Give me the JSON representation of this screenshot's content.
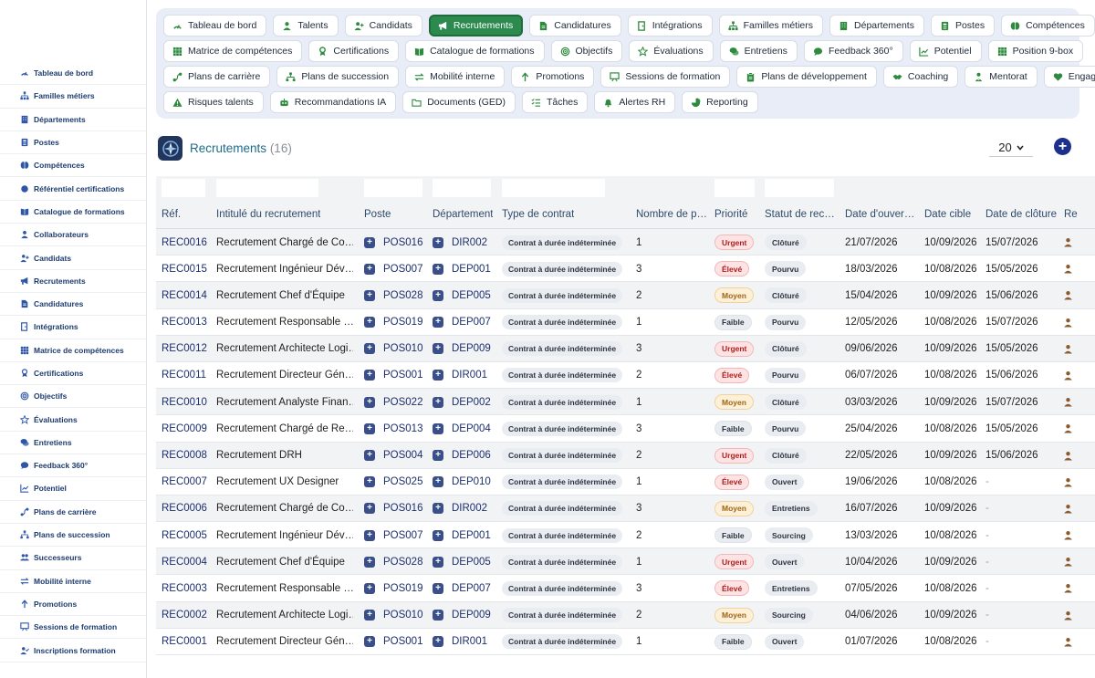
{
  "sidebar": {
    "items": [
      {
        "label": "Tableau de bord",
        "icon": "dashboard-icon"
      },
      {
        "label": "Familles métiers",
        "icon": "hierarchy-icon"
      },
      {
        "label": "Départements",
        "icon": "building-icon"
      },
      {
        "label": "Postes",
        "icon": "id-card-icon"
      },
      {
        "label": "Compétences",
        "icon": "brain-icon"
      },
      {
        "label": "Référentiel certifications",
        "icon": "certificate-icon"
      },
      {
        "label": "Catalogue de formations",
        "icon": "book-icon"
      },
      {
        "label": "Collaborateurs",
        "icon": "user-icon"
      },
      {
        "label": "Candidats",
        "icon": "user-plus-icon"
      },
      {
        "label": "Recrutements",
        "icon": "megaphone-icon"
      },
      {
        "label": "Candidatures",
        "icon": "file-icon"
      },
      {
        "label": "Intégrations",
        "icon": "door-icon"
      },
      {
        "label": "Matrice de compétences",
        "icon": "grid-icon"
      },
      {
        "label": "Certifications",
        "icon": "award-icon"
      },
      {
        "label": "Objectifs",
        "icon": "target-icon"
      },
      {
        "label": "Évaluations",
        "icon": "star-icon"
      },
      {
        "label": "Entretiens",
        "icon": "comments-icon"
      },
      {
        "label": "Feedback 360°",
        "icon": "comment-icon"
      },
      {
        "label": "Potentiel",
        "icon": "chart-icon"
      },
      {
        "label": "Plans de carrière",
        "icon": "route-icon"
      },
      {
        "label": "Plans de succession",
        "icon": "sitemap-icon"
      },
      {
        "label": "Successeurs",
        "icon": "users-icon"
      },
      {
        "label": "Mobilité interne",
        "icon": "exchange-icon"
      },
      {
        "label": "Promotions",
        "icon": "arrow-up-icon"
      },
      {
        "label": "Sessions de formation",
        "icon": "chalkboard-icon"
      },
      {
        "label": "Inscriptions formation",
        "icon": "user-check-icon"
      }
    ]
  },
  "topnav": {
    "rows": [
      [
        {
          "label": "Tableau de bord",
          "icon": "dashboard-icon",
          "active": false
        },
        {
          "label": "Talents",
          "icon": "user-icon",
          "active": false
        },
        {
          "label": "Candidats",
          "icon": "user-plus-icon",
          "active": false
        },
        {
          "label": "Recrutements",
          "icon": "megaphone-icon",
          "active": true
        },
        {
          "label": "Candidatures",
          "icon": "file-icon",
          "active": false
        },
        {
          "label": "Intégrations",
          "icon": "door-icon",
          "active": false
        },
        {
          "label": "Familles métiers",
          "icon": "hierarchy-icon",
          "active": false
        },
        {
          "label": "Départements",
          "icon": "building-icon",
          "active": false
        },
        {
          "label": "Postes",
          "icon": "id-card-icon",
          "active": false
        },
        {
          "label": "Compétences",
          "icon": "brain-icon",
          "active": false
        }
      ],
      [
        {
          "label": "Matrice de compétences",
          "icon": "grid-icon",
          "active": false
        },
        {
          "label": "Certifications",
          "icon": "award-icon",
          "active": false
        },
        {
          "label": "Catalogue de formations",
          "icon": "book-icon",
          "active": false
        },
        {
          "label": "Objectifs",
          "icon": "target-icon",
          "active": false
        },
        {
          "label": "Évaluations",
          "icon": "star-icon",
          "active": false
        },
        {
          "label": "Entretiens",
          "icon": "comments-icon",
          "active": false
        },
        {
          "label": "Feedback 360°",
          "icon": "comment-icon",
          "active": false
        },
        {
          "label": "Potentiel",
          "icon": "chart-icon",
          "active": false
        },
        {
          "label": "Position 9-box",
          "icon": "grid-icon",
          "active": false
        }
      ],
      [
        {
          "label": "Plans de carrière",
          "icon": "route-icon",
          "active": false
        },
        {
          "label": "Plans de succession",
          "icon": "sitemap-icon",
          "active": false
        },
        {
          "label": "Mobilité interne",
          "icon": "exchange-icon",
          "active": false
        },
        {
          "label": "Promotions",
          "icon": "arrow-up-icon",
          "active": false
        },
        {
          "label": "Sessions de formation",
          "icon": "chalkboard-icon",
          "active": false
        },
        {
          "label": "Plans de développement",
          "icon": "clipboard-icon",
          "active": false
        },
        {
          "label": "Coaching",
          "icon": "handshake-icon",
          "active": false
        },
        {
          "label": "Mentorat",
          "icon": "mentor-icon",
          "active": false
        },
        {
          "label": "Engagement",
          "icon": "heart-icon",
          "active": false
        }
      ],
      [
        {
          "label": "Risques talents",
          "icon": "warning-icon",
          "active": false
        },
        {
          "label": "Recommandations IA",
          "icon": "robot-icon",
          "active": false
        },
        {
          "label": "Documents (GED)",
          "icon": "folder-icon",
          "active": false
        },
        {
          "label": "Tâches",
          "icon": "tasks-icon",
          "active": false
        },
        {
          "label": "Alertes RH",
          "icon": "bell-icon",
          "active": false
        },
        {
          "label": "Reporting",
          "icon": "pie-icon",
          "active": false
        }
      ]
    ]
  },
  "page": {
    "title": "Recrutements",
    "count": "(16)",
    "page_size": "20",
    "add_symbol": "+"
  },
  "table": {
    "columns": [
      "Réf.",
      "Intitulé du recrutement",
      "Poste",
      "Département",
      "Type de contrat",
      "Nombre de p…",
      "Priorité",
      "Statut de rec…",
      "Date d'ouver…",
      "Date cible",
      "Date de clôture",
      "Re"
    ],
    "rows": [
      {
        "ref": "REC0016",
        "intitule": "Recrutement Chargé de Co…",
        "poste": "POS016",
        "dep": "DIR002",
        "type": "Contrat à durée indéterminée",
        "nb": "1",
        "priorite": "Urgent",
        "statut": "Clôturé",
        "ouverture": "21/07/2026",
        "cible": "10/09/2026",
        "cloture": "15/07/2026"
      },
      {
        "ref": "REC0015",
        "intitule": "Recrutement Ingénieur Dév…",
        "poste": "POS007",
        "dep": "DEP001",
        "type": "Contrat à durée indéterminée",
        "nb": "3",
        "priorite": "Élevé",
        "statut": "Pourvu",
        "ouverture": "18/03/2026",
        "cible": "10/08/2026",
        "cloture": "15/05/2026"
      },
      {
        "ref": "REC0014",
        "intitule": "Recrutement Chef d'Équipe",
        "poste": "POS028",
        "dep": "DEP005",
        "type": "Contrat à durée indéterminée",
        "nb": "2",
        "priorite": "Moyen",
        "statut": "Clôturé",
        "ouverture": "15/04/2026",
        "cible": "10/09/2026",
        "cloture": "15/06/2026"
      },
      {
        "ref": "REC0013",
        "intitule": "Recrutement Responsable …",
        "poste": "POS019",
        "dep": "DEP007",
        "type": "Contrat à durée indéterminée",
        "nb": "1",
        "priorite": "Faible",
        "statut": "Pourvu",
        "ouverture": "12/05/2026",
        "cible": "10/08/2026",
        "cloture": "15/07/2026"
      },
      {
        "ref": "REC0012",
        "intitule": "Recrutement Architecte Logi…",
        "poste": "POS010",
        "dep": "DEP009",
        "type": "Contrat à durée indéterminée",
        "nb": "3",
        "priorite": "Urgent",
        "statut": "Clôturé",
        "ouverture": "09/06/2026",
        "cible": "10/09/2026",
        "cloture": "15/05/2026"
      },
      {
        "ref": "REC0011",
        "intitule": "Recrutement Directeur Gén…",
        "poste": "POS001",
        "dep": "DIR001",
        "type": "Contrat à durée indéterminée",
        "nb": "2",
        "priorite": "Élevé",
        "statut": "Pourvu",
        "ouverture": "06/07/2026",
        "cible": "10/08/2026",
        "cloture": "15/06/2026"
      },
      {
        "ref": "REC0010",
        "intitule": "Recrutement Analyste Finan…",
        "poste": "POS022",
        "dep": "DEP002",
        "type": "Contrat à durée indéterminée",
        "nb": "1",
        "priorite": "Moyen",
        "statut": "Clôturé",
        "ouverture": "03/03/2026",
        "cible": "10/09/2026",
        "cloture": "15/07/2026"
      },
      {
        "ref": "REC0009",
        "intitule": "Recrutement Chargé de Re…",
        "poste": "POS013",
        "dep": "DEP004",
        "type": "Contrat à durée indéterminée",
        "nb": "3",
        "priorite": "Faible",
        "statut": "Pourvu",
        "ouverture": "25/04/2026",
        "cible": "10/08/2026",
        "cloture": "15/05/2026"
      },
      {
        "ref": "REC0008",
        "intitule": "Recrutement DRH",
        "poste": "POS004",
        "dep": "DEP006",
        "type": "Contrat à durée indéterminée",
        "nb": "2",
        "priorite": "Urgent",
        "statut": "Clôturé",
        "ouverture": "22/05/2026",
        "cible": "10/09/2026",
        "cloture": "15/06/2026"
      },
      {
        "ref": "REC0007",
        "intitule": "Recrutement UX Designer",
        "poste": "POS025",
        "dep": "DEP010",
        "type": "Contrat à durée indéterminée",
        "nb": "1",
        "priorite": "Élevé",
        "statut": "Ouvert",
        "ouverture": "19/06/2026",
        "cible": "10/08/2026",
        "cloture": "-"
      },
      {
        "ref": "REC0006",
        "intitule": "Recrutement Chargé de Co…",
        "poste": "POS016",
        "dep": "DIR002",
        "type": "Contrat à durée indéterminée",
        "nb": "3",
        "priorite": "Moyen",
        "statut": "Entretiens",
        "ouverture": "16/07/2026",
        "cible": "10/09/2026",
        "cloture": "-"
      },
      {
        "ref": "REC0005",
        "intitule": "Recrutement Ingénieur Dév…",
        "poste": "POS007",
        "dep": "DEP001",
        "type": "Contrat à durée indéterminée",
        "nb": "2",
        "priorite": "Faible",
        "statut": "Sourcing",
        "ouverture": "13/03/2026",
        "cible": "10/08/2026",
        "cloture": "-"
      },
      {
        "ref": "REC0004",
        "intitule": "Recrutement Chef d'Équipe",
        "poste": "POS028",
        "dep": "DEP005",
        "type": "Contrat à durée indéterminée",
        "nb": "1",
        "priorite": "Urgent",
        "statut": "Ouvert",
        "ouverture": "10/04/2026",
        "cible": "10/09/2026",
        "cloture": "-"
      },
      {
        "ref": "REC0003",
        "intitule": "Recrutement Responsable …",
        "poste": "POS019",
        "dep": "DEP007",
        "type": "Contrat à durée indéterminée",
        "nb": "3",
        "priorite": "Élevé",
        "statut": "Entretiens",
        "ouverture": "07/05/2026",
        "cible": "10/08/2026",
        "cloture": "-"
      },
      {
        "ref": "REC0002",
        "intitule": "Recrutement Architecte Logi…",
        "poste": "POS010",
        "dep": "DEP009",
        "type": "Contrat à durée indéterminée",
        "nb": "2",
        "priorite": "Moyen",
        "statut": "Sourcing",
        "ouverture": "04/06/2026",
        "cible": "10/09/2026",
        "cloture": "-"
      },
      {
        "ref": "REC0001",
        "intitule": "Recrutement Directeur Gén…",
        "poste": "POS001",
        "dep": "DIR001",
        "type": "Contrat à durée indéterminée",
        "nb": "1",
        "priorite": "Faible",
        "statut": "Ouvert",
        "ouverture": "01/07/2026",
        "cible": "10/08/2026",
        "cloture": "-"
      }
    ]
  },
  "colors": {
    "accent_green": "#2d8a4e",
    "nav_bg": "#e8edf7",
    "link_navy": "#1c2f6e",
    "urgent_red": "#b11d1d",
    "moyen_amber": "#a06412"
  }
}
